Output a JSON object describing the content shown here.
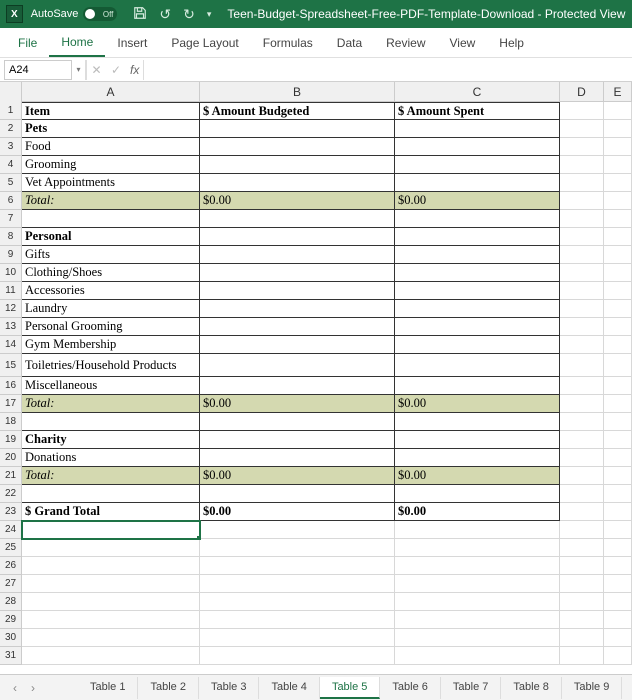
{
  "titlebar": {
    "autosave_label": "AutoSave",
    "autosave_state": "Off",
    "doc_title": "Teen-Budget-Spreadsheet-Free-PDF-Template-Download  -  Protected View  -  Com"
  },
  "ribbon": {
    "tabs": [
      "File",
      "Home",
      "Insert",
      "Page Layout",
      "Formulas",
      "Data",
      "Review",
      "View",
      "Help"
    ]
  },
  "namebox": "A24",
  "fx_label": "fx",
  "columns": [
    "A",
    "B",
    "C",
    "D",
    "E"
  ],
  "sheet": {
    "nav_prev": "‹",
    "nav_next": "›",
    "tabs": [
      "Table 1",
      "Table 2",
      "Table 3",
      "Table 4",
      "Table 5",
      "Table 6",
      "Table 7",
      "Table 8",
      "Table 9"
    ],
    "active": 4
  },
  "rows": [
    {
      "n": "1",
      "a": "Item",
      "b": "$ Amount Budgeted",
      "c": "$ Amount Spent",
      "cls": "bold",
      "tc": true,
      "top": true
    },
    {
      "n": "2",
      "a": "Pets",
      "b": "",
      "c": "",
      "cls": "bold",
      "tc": true
    },
    {
      "n": "3",
      "a": "Food",
      "b": "",
      "c": "",
      "cls": "",
      "tc": true
    },
    {
      "n": "4",
      "a": "Grooming",
      "b": "",
      "c": "",
      "cls": "",
      "tc": true
    },
    {
      "n": "5",
      "a": "Vet Appointments",
      "b": "",
      "c": "",
      "cls": "",
      "tc": true
    },
    {
      "n": "6",
      "a": "Total:",
      "b": "$0.00",
      "c": "$0.00",
      "cls": "italic",
      "tc": true,
      "tot": true
    },
    {
      "n": "7",
      "a": "",
      "b": "",
      "c": "",
      "cls": "",
      "tc": true
    },
    {
      "n": "8",
      "a": "Personal",
      "b": "",
      "c": "",
      "cls": "bold",
      "tc": true
    },
    {
      "n": "9",
      "a": "Gifts",
      "b": "",
      "c": "",
      "cls": "",
      "tc": true
    },
    {
      "n": "10",
      "a": "Clothing/Shoes",
      "b": "",
      "c": "",
      "cls": "",
      "tc": true
    },
    {
      "n": "11",
      "a": "Accessories",
      "b": "",
      "c": "",
      "cls": "",
      "tc": true
    },
    {
      "n": "12",
      "a": "Laundry",
      "b": "",
      "c": "",
      "cls": "",
      "tc": true
    },
    {
      "n": "13",
      "a": "Personal Grooming",
      "b": "",
      "c": "",
      "cls": "",
      "tc": true
    },
    {
      "n": "14",
      "a": "Gym Membership",
      "b": "",
      "c": "",
      "cls": "",
      "tc": true
    },
    {
      "n": "15",
      "a": "Toiletries/Household Products",
      "b": "",
      "c": "",
      "cls": "",
      "tc": true,
      "tall": true
    },
    {
      "n": "16",
      "a": "Miscellaneous",
      "b": "",
      "c": "",
      "cls": "",
      "tc": true
    },
    {
      "n": "17",
      "a": "Total:",
      "b": "$0.00",
      "c": "$0.00",
      "cls": "italic",
      "tc": true,
      "tot": true
    },
    {
      "n": "18",
      "a": "",
      "b": "",
      "c": "",
      "cls": "",
      "tc": true
    },
    {
      "n": "19",
      "a": "Charity",
      "b": "",
      "c": "",
      "cls": "bold",
      "tc": true
    },
    {
      "n": "20",
      "a": "Donations",
      "b": "",
      "c": "",
      "cls": "",
      "tc": true
    },
    {
      "n": "21",
      "a": "Total:",
      "b": "$0.00",
      "c": "$0.00",
      "cls": "italic",
      "tc": true,
      "tot": true
    },
    {
      "n": "22",
      "a": "",
      "b": "",
      "c": "",
      "cls": "",
      "tc": true
    },
    {
      "n": "23",
      "a": "$ Grand Total",
      "b": "$0.00",
      "c": "$0.00",
      "cls": "bold",
      "tc": true
    },
    {
      "n": "24",
      "a": "",
      "b": "",
      "c": "",
      "cls": "",
      "tc": false,
      "sel": true
    },
    {
      "n": "25",
      "a": "",
      "b": "",
      "c": "",
      "cls": "",
      "tc": false
    },
    {
      "n": "26",
      "a": "",
      "b": "",
      "c": "",
      "cls": "",
      "tc": false
    },
    {
      "n": "27",
      "a": "",
      "b": "",
      "c": "",
      "cls": "",
      "tc": false
    },
    {
      "n": "28",
      "a": "",
      "b": "",
      "c": "",
      "cls": "",
      "tc": false
    },
    {
      "n": "29",
      "a": "",
      "b": "",
      "c": "",
      "cls": "",
      "tc": false
    },
    {
      "n": "30",
      "a": "",
      "b": "",
      "c": "",
      "cls": "",
      "tc": false
    },
    {
      "n": "31",
      "a": "",
      "b": "",
      "c": "",
      "cls": "",
      "tc": false
    }
  ]
}
